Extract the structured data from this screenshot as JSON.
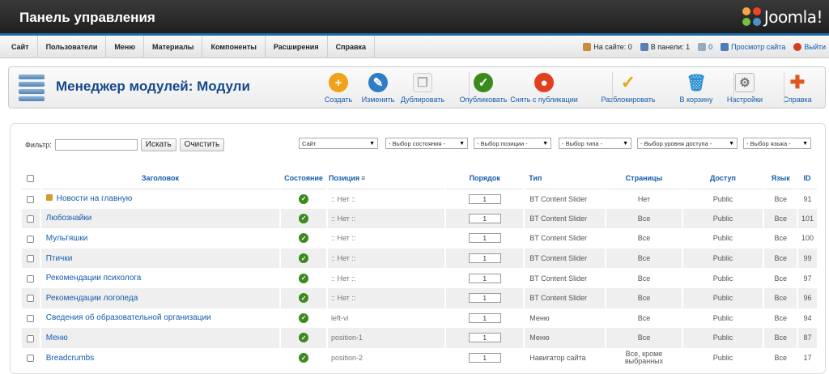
{
  "header": {
    "title": "Панель управления",
    "logo_text": "Joomla!"
  },
  "menu": [
    "Сайт",
    "Пользователи",
    "Меню",
    "Материалы",
    "Компоненты",
    "Расширения",
    "Справка"
  ],
  "status": {
    "on_site": "На сайте: 0",
    "in_panel": "В панели: 1",
    "messages": "0",
    "preview": "Просмотр сайта",
    "logout": "Выйти"
  },
  "page_title": "Менеджер модулей: Модули",
  "toolbar": [
    {
      "label": "Создать",
      "color": "#f0a21a",
      "glyph": "+"
    },
    {
      "label": "Изменить",
      "color": "#2f7cc7",
      "glyph": "✎"
    },
    {
      "label": "Дублировать",
      "color": "#bbbbbb",
      "glyph": "❐"
    },
    {
      "label": "Опубликовать",
      "color": "#3c8a1e",
      "glyph": "✓"
    },
    {
      "label": "Снять с публикации",
      "color": "#e0401f",
      "glyph": "●"
    },
    {
      "label": "Разблокировать",
      "color": "#f0a21a",
      "glyph": "✓"
    },
    {
      "label": "В корзину",
      "color": "#2a8fd3",
      "glyph": "🗑"
    },
    {
      "label": "Настройки",
      "color": "#9a9a9a",
      "glyph": "⚙"
    },
    {
      "label": "Справка",
      "color": "#e0561f",
      "glyph": "✚"
    }
  ],
  "filter": {
    "label": "Фильтр:",
    "value": "",
    "search_button": "Искать",
    "clear_button": "Очистить"
  },
  "selects": [
    "Сайт",
    "- Выбор состояния -",
    "- Выбор позиции -",
    "- Выбор типа -",
    "- Выбор уровня доступа -",
    "- Выбор языка -"
  ],
  "table": {
    "headers": [
      "Заголовок",
      "Состояние",
      "Позиция",
      "Порядок",
      "Тип",
      "Страницы",
      "Доступ",
      "Язык",
      "ID"
    ],
    "rows": [
      {
        "title": "Новости на главную",
        "locked": true,
        "position": ":: Нет ::",
        "order": "1",
        "type": "BT Content Slider",
        "pages": "Нет",
        "access": "Public",
        "lang": "Все",
        "id": "91"
      },
      {
        "title": "Любознайки",
        "locked": false,
        "position": ":: Нет ::",
        "order": "1",
        "type": "BT Content Slider",
        "pages": "Все",
        "access": "Public",
        "lang": "Все",
        "id": "101"
      },
      {
        "title": "Мультяшки",
        "locked": false,
        "position": ":: Нет ::",
        "order": "1",
        "type": "BT Content Slider",
        "pages": "Все",
        "access": "Public",
        "lang": "Все",
        "id": "100"
      },
      {
        "title": "Птички",
        "locked": false,
        "position": ":: Нет ::",
        "order": "1",
        "type": "BT Content Slider",
        "pages": "Все",
        "access": "Public",
        "lang": "Все",
        "id": "99"
      },
      {
        "title": "Рекомендации психолога",
        "locked": false,
        "position": ":: Нет ::",
        "order": "1",
        "type": "BT Content Slider",
        "pages": "Все",
        "access": "Public",
        "lang": "Все",
        "id": "97"
      },
      {
        "title": "Рекомендации логопеда",
        "locked": false,
        "position": ":: Нет ::",
        "order": "1",
        "type": "BT Content Slider",
        "pages": "Все",
        "access": "Public",
        "lang": "Все",
        "id": "96"
      },
      {
        "title": "Сведения об образовательной организации",
        "locked": false,
        "position": "left-vi",
        "order": "1",
        "type": "Меню",
        "pages": "Все",
        "access": "Public",
        "lang": "Все",
        "id": "94"
      },
      {
        "title": "Меню",
        "locked": false,
        "position": "position-1",
        "order": "1",
        "type": "Меню",
        "pages": "Все",
        "access": "Public",
        "lang": "Все",
        "id": "87"
      },
      {
        "title": "Breadcrumbs",
        "locked": false,
        "position": "position-2",
        "order": "1",
        "type": "Навигатор сайта",
        "pages": "Все, кроме выбранных",
        "access": "Public",
        "lang": "Все",
        "id": "17"
      }
    ]
  }
}
